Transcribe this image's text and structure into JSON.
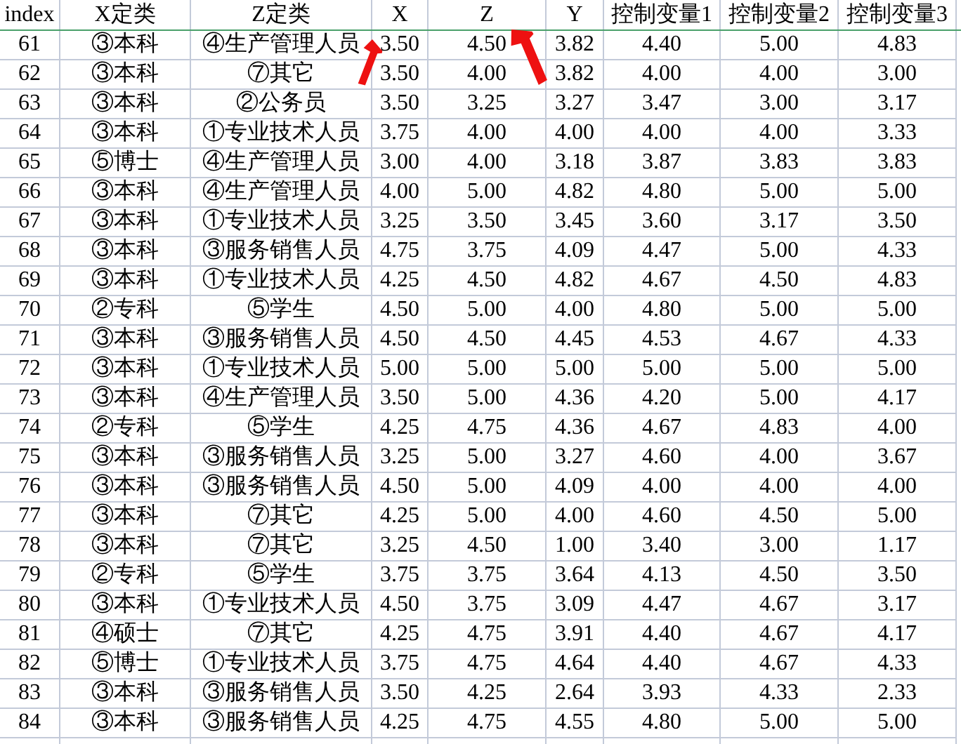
{
  "table": {
    "columns": [
      "index",
      "X定类",
      "Z定类",
      "X",
      "Z",
      "Y",
      "控制变量1",
      "控制变量2",
      "控制变量3"
    ],
    "rows": [
      [
        "61",
        "③本科",
        "④生产管理人员",
        "3.50",
        "4.50",
        "3.82",
        "4.40",
        "5.00",
        "4.83"
      ],
      [
        "62",
        "③本科",
        "⑦其它",
        "3.50",
        "4.00",
        "3.82",
        "4.00",
        "4.00",
        "3.00"
      ],
      [
        "63",
        "③本科",
        "②公务员",
        "3.50",
        "3.25",
        "3.27",
        "3.47",
        "3.00",
        "3.17"
      ],
      [
        "64",
        "③本科",
        "①专业技术人员",
        "3.75",
        "4.00",
        "4.00",
        "4.00",
        "4.00",
        "3.33"
      ],
      [
        "65",
        "⑤博士",
        "④生产管理人员",
        "3.00",
        "4.00",
        "3.18",
        "3.87",
        "3.83",
        "3.83"
      ],
      [
        "66",
        "③本科",
        "④生产管理人员",
        "4.00",
        "5.00",
        "4.82",
        "4.80",
        "5.00",
        "5.00"
      ],
      [
        "67",
        "③本科",
        "①专业技术人员",
        "3.25",
        "3.50",
        "3.45",
        "3.60",
        "3.17",
        "3.50"
      ],
      [
        "68",
        "③本科",
        "③服务销售人员",
        "4.75",
        "3.75",
        "4.09",
        "4.47",
        "5.00",
        "4.33"
      ],
      [
        "69",
        "③本科",
        "①专业技术人员",
        "4.25",
        "4.50",
        "4.82",
        "4.67",
        "4.50",
        "4.83"
      ],
      [
        "70",
        "②专科",
        "⑤学生",
        "4.50",
        "5.00",
        "4.00",
        "4.80",
        "5.00",
        "5.00"
      ],
      [
        "71",
        "③本科",
        "③服务销售人员",
        "4.50",
        "4.50",
        "4.45",
        "4.53",
        "4.67",
        "4.33"
      ],
      [
        "72",
        "③本科",
        "①专业技术人员",
        "5.00",
        "5.00",
        "5.00",
        "5.00",
        "5.00",
        "5.00"
      ],
      [
        "73",
        "③本科",
        "④生产管理人员",
        "3.50",
        "5.00",
        "4.36",
        "4.20",
        "5.00",
        "4.17"
      ],
      [
        "74",
        "②专科",
        "⑤学生",
        "4.25",
        "4.75",
        "4.36",
        "4.67",
        "4.83",
        "4.00"
      ],
      [
        "75",
        "③本科",
        "③服务销售人员",
        "3.25",
        "5.00",
        "3.27",
        "4.60",
        "4.00",
        "3.67"
      ],
      [
        "76",
        "③本科",
        "③服务销售人员",
        "4.50",
        "5.00",
        "4.09",
        "4.00",
        "4.00",
        "4.00"
      ],
      [
        "77",
        "③本科",
        "⑦其它",
        "4.25",
        "5.00",
        "4.00",
        "4.60",
        "4.50",
        "5.00"
      ],
      [
        "78",
        "③本科",
        "⑦其它",
        "3.25",
        "4.50",
        "1.00",
        "3.40",
        "3.00",
        "1.17"
      ],
      [
        "79",
        "②专科",
        "⑤学生",
        "3.75",
        "3.75",
        "3.64",
        "4.13",
        "4.50",
        "3.50"
      ],
      [
        "80",
        "③本科",
        "①专业技术人员",
        "4.50",
        "3.75",
        "3.09",
        "4.47",
        "4.67",
        "3.17"
      ],
      [
        "81",
        "④硕士",
        "⑦其它",
        "4.25",
        "4.75",
        "3.91",
        "4.40",
        "4.67",
        "4.17"
      ],
      [
        "82",
        "⑤博士",
        "①专业技术人员",
        "3.75",
        "4.75",
        "4.64",
        "4.40",
        "4.67",
        "4.33"
      ],
      [
        "83",
        "③本科",
        "③服务销售人员",
        "3.50",
        "4.25",
        "2.64",
        "3.93",
        "4.33",
        "2.33"
      ],
      [
        "84",
        "③本科",
        "③服务销售人员",
        "4.25",
        "4.75",
        "4.55",
        "4.80",
        "5.00",
        "5.00"
      ]
    ]
  },
  "annotation_arrows": [
    {
      "kind": "arrow"
    },
    {
      "kind": "arrow"
    }
  ]
}
